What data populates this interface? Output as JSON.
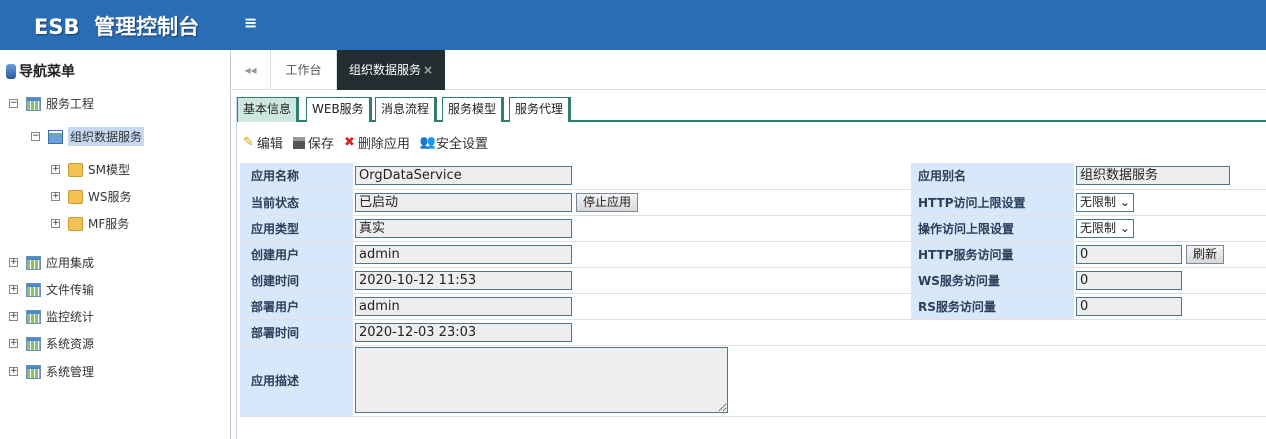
{
  "header": {
    "title": "ESB  管理控制台",
    "menu_icon": "≡"
  },
  "sidebar": {
    "title": "导航菜单",
    "items": [
      {
        "label": "服务工程",
        "toggle": "−"
      },
      {
        "label": "组织数据服务",
        "toggle": "−"
      },
      {
        "label": "SM模型",
        "toggle": "+"
      },
      {
        "label": "WS服务",
        "toggle": "+"
      },
      {
        "label": "MF服务",
        "toggle": "+"
      },
      {
        "label": "应用集成",
        "toggle": "+"
      },
      {
        "label": "文件传输",
        "toggle": "+"
      },
      {
        "label": "监控统计",
        "toggle": "+"
      },
      {
        "label": "系统资源",
        "toggle": "+"
      },
      {
        "label": "系统管理",
        "toggle": "+"
      }
    ]
  },
  "tabs": {
    "back": "◂◂",
    "workbench": "工作台",
    "active": "组织数据服务",
    "close": "×"
  },
  "subtabs": [
    "基本信息",
    "WEB服务",
    "消息流程",
    "服务模型",
    "服务代理"
  ],
  "toolbar": {
    "edit": "编辑",
    "save": "保存",
    "delete": "删除应用",
    "security": "安全设置"
  },
  "form": {
    "app_name_label": "应用名称",
    "app_name": "OrgDataService",
    "status_label": "当前状态",
    "status": "已启动",
    "stop_button": "停止应用",
    "type_label": "应用类型",
    "type": "真实",
    "creator_label": "创建用户",
    "creator": "admin",
    "created_label": "创建时间",
    "created": "2020-10-12 11:53",
    "deployer_label": "部署用户",
    "deployer": "admin",
    "deployed_label": "部署时间",
    "deployed": "2020-12-03 23:03",
    "desc_label": "应用描述",
    "desc": "",
    "alias_label": "应用别名",
    "alias": "组织数据服务",
    "http_limit_label": "HTTP访问上限设置",
    "http_limit": "无限制",
    "op_limit_label": "操作访问上限设置",
    "op_limit": "无限制",
    "http_count_label": "HTTP服务访问量",
    "http_count": "0",
    "refresh_button": "刷新",
    "ws_count_label": "WS服务访问量",
    "ws_count": "0",
    "rs_count_label": "RS服务访问量",
    "rs_count": "0"
  }
}
